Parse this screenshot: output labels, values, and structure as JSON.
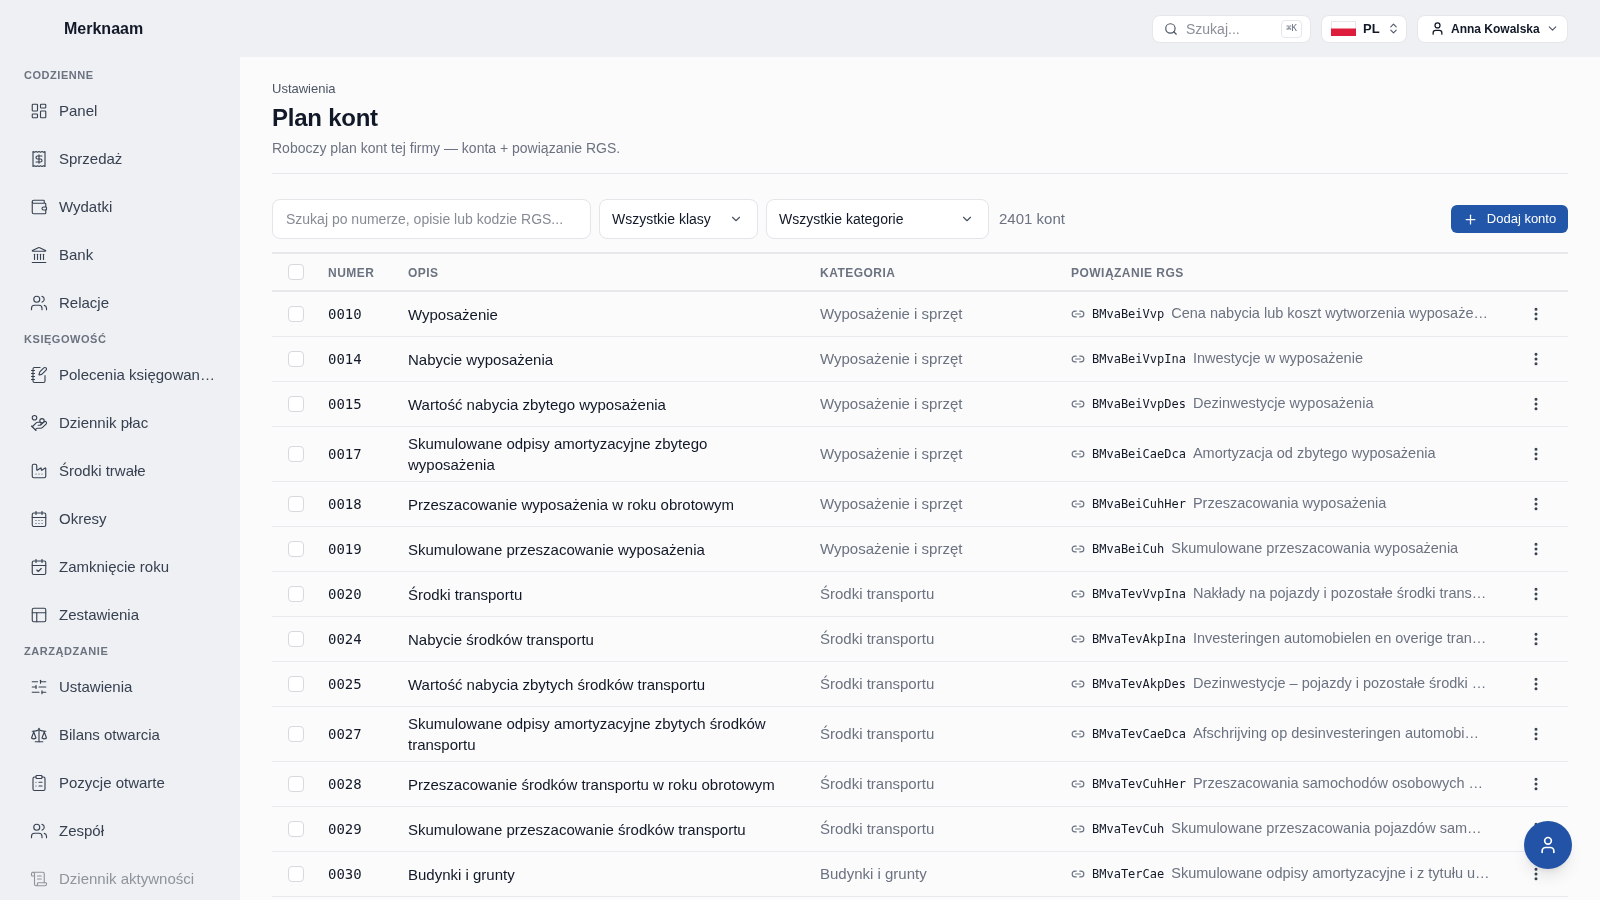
{
  "header": {
    "brand": "Merknaam",
    "search": {
      "placeholder": "Szukaj...",
      "shortcut": "⌘K"
    },
    "language": {
      "code": "PL"
    },
    "user": {
      "name": "Anna Kowalska"
    }
  },
  "sidebar": {
    "sections": [
      {
        "title": "CODZIENNE",
        "items": [
          {
            "label": "Panel",
            "selected": false,
            "disabled": false
          },
          {
            "label": "Sprzedaż",
            "selected": false,
            "disabled": false
          },
          {
            "label": "Wydatki",
            "selected": false,
            "disabled": false
          },
          {
            "label": "Bank",
            "selected": false,
            "disabled": false
          },
          {
            "label": "Relacje",
            "selected": false,
            "disabled": false
          }
        ]
      },
      {
        "title": "KSIĘGOWOŚĆ",
        "items": [
          {
            "label": "Polecenia księgowan…",
            "selected": false,
            "disabled": false
          },
          {
            "label": "Dziennik płac",
            "selected": false,
            "disabled": false
          },
          {
            "label": "Środki trwałe",
            "selected": false,
            "disabled": false
          },
          {
            "label": "Okresy",
            "selected": false,
            "disabled": false
          },
          {
            "label": "Zamknięcie roku",
            "selected": false,
            "disabled": false
          },
          {
            "label": "Zestawienia",
            "selected": false,
            "disabled": false
          }
        ]
      },
      {
        "title": "ZARZĄDZANIE",
        "items": [
          {
            "label": "Ustawienia",
            "selected": false,
            "disabled": false
          },
          {
            "label": "Bilans otwarcia",
            "selected": false,
            "disabled": false
          },
          {
            "label": "Pozycje otwarte",
            "selected": false,
            "disabled": false
          },
          {
            "label": "Zespół",
            "selected": false,
            "disabled": false
          },
          {
            "label": "Dziennik aktywności",
            "selected": false,
            "disabled": true
          }
        ]
      }
    ]
  },
  "page": {
    "breadcrumb": "Ustawienia",
    "title": "Plan kont",
    "subtitle": "Roboczy plan kont tej firmy — konta + powiązanie RGS."
  },
  "filters": {
    "search": {
      "placeholder": "Szukaj po numerze, opisie lub kodzie RGS..."
    },
    "class_select": {
      "value": "Wszystkie klasy"
    },
    "category_select": {
      "value": "Wszystkie kategorie"
    },
    "count": "2401 kont",
    "add_button": "Dodaj konto"
  },
  "table": {
    "select_all": {
      "checked": false
    },
    "columns": [
      "NUMER",
      "OPIS",
      "KATEGORIA",
      "POWIĄZANIE RGS"
    ],
    "rows": [
      {
        "checked": false,
        "number": "0010",
        "description": "Wyposażenie",
        "category": "Wyposażenie i sprzęt",
        "rgs_code": "BMvaBeiVvp",
        "rgs_description": "Cena nabycia lub koszt wytworzenia wyposaże…"
      },
      {
        "checked": false,
        "number": "0014",
        "description": "Nabycie wyposażenia",
        "category": "Wyposażenie i sprzęt",
        "rgs_code": "BMvaBeiVvpIna",
        "rgs_description": "Inwestycje w wyposażenie"
      },
      {
        "checked": false,
        "number": "0015",
        "description": "Wartość nabycia zbytego wyposażenia",
        "category": "Wyposażenie i sprzęt",
        "rgs_code": "BMvaBeiVvpDes",
        "rgs_description": "Dezinwestycje wyposażenia"
      },
      {
        "checked": false,
        "number": "0017",
        "description": "Skumulowane odpisy amortyzacyjne zbytego wyposażenia",
        "category": "Wyposażenie i sprzęt",
        "rgs_code": "BMvaBeiCaeDca",
        "rgs_description": "Amortyzacja od zbytego wyposażenia"
      },
      {
        "checked": false,
        "number": "0018",
        "description": "Przeszacowanie wyposażenia w roku obrotowym",
        "category": "Wyposażenie i sprzęt",
        "rgs_code": "BMvaBeiCuhHer",
        "rgs_description": "Przeszacowania wyposażenia"
      },
      {
        "checked": false,
        "number": "0019",
        "description": "Skumulowane przeszacowanie wyposażenia",
        "category": "Wyposażenie i sprzęt",
        "rgs_code": "BMvaBeiCuh",
        "rgs_description": "Skumulowane przeszacowania wyposażenia"
      },
      {
        "checked": false,
        "number": "0020",
        "description": "Środki transportu",
        "category": "Środki transportu",
        "rgs_code": "BMvaTevVvpIna",
        "rgs_description": "Nakłady na pojazdy i pozostałe środki trans…"
      },
      {
        "checked": false,
        "number": "0024",
        "description": "Nabycie środków transportu",
        "category": "Środki transportu",
        "rgs_code": "BMvaTevAkpIna",
        "rgs_description": "Investeringen automobielen en overige tran…"
      },
      {
        "checked": false,
        "number": "0025",
        "description": "Wartość nabycia zbytych środków transportu",
        "category": "Środki transportu",
        "rgs_code": "BMvaTevAkpDes",
        "rgs_description": "Dezinwestycje – pojazdy i pozostałe środki …"
      },
      {
        "checked": false,
        "number": "0027",
        "description": "Skumulowane odpisy amortyzacyjne zbytych środków transportu",
        "category": "Środki transportu",
        "rgs_code": "BMvaTevCaeDca",
        "rgs_description": "Afschrijving op desinvesteringen automobi…"
      },
      {
        "checked": false,
        "number": "0028",
        "description": "Przeszacowanie środków transportu w roku obrotowym",
        "category": "Środki transportu",
        "rgs_code": "BMvaTevCuhHer",
        "rgs_description": "Przeszacowania samochodów osobowych …"
      },
      {
        "checked": false,
        "number": "0029",
        "description": "Skumulowane przeszacowanie środków transportu",
        "category": "Środki transportu",
        "rgs_code": "BMvaTevCuh",
        "rgs_description": "Skumulowane przeszacowania pojazdów sam…"
      },
      {
        "checked": false,
        "number": "0030",
        "description": "Budynki i grunty",
        "category": "Budynki i grunty",
        "rgs_code": "BMvaTerCae",
        "rgs_description": "Skumulowane odpisy amortyzacyjne i z tytułu u…"
      }
    ]
  }
}
